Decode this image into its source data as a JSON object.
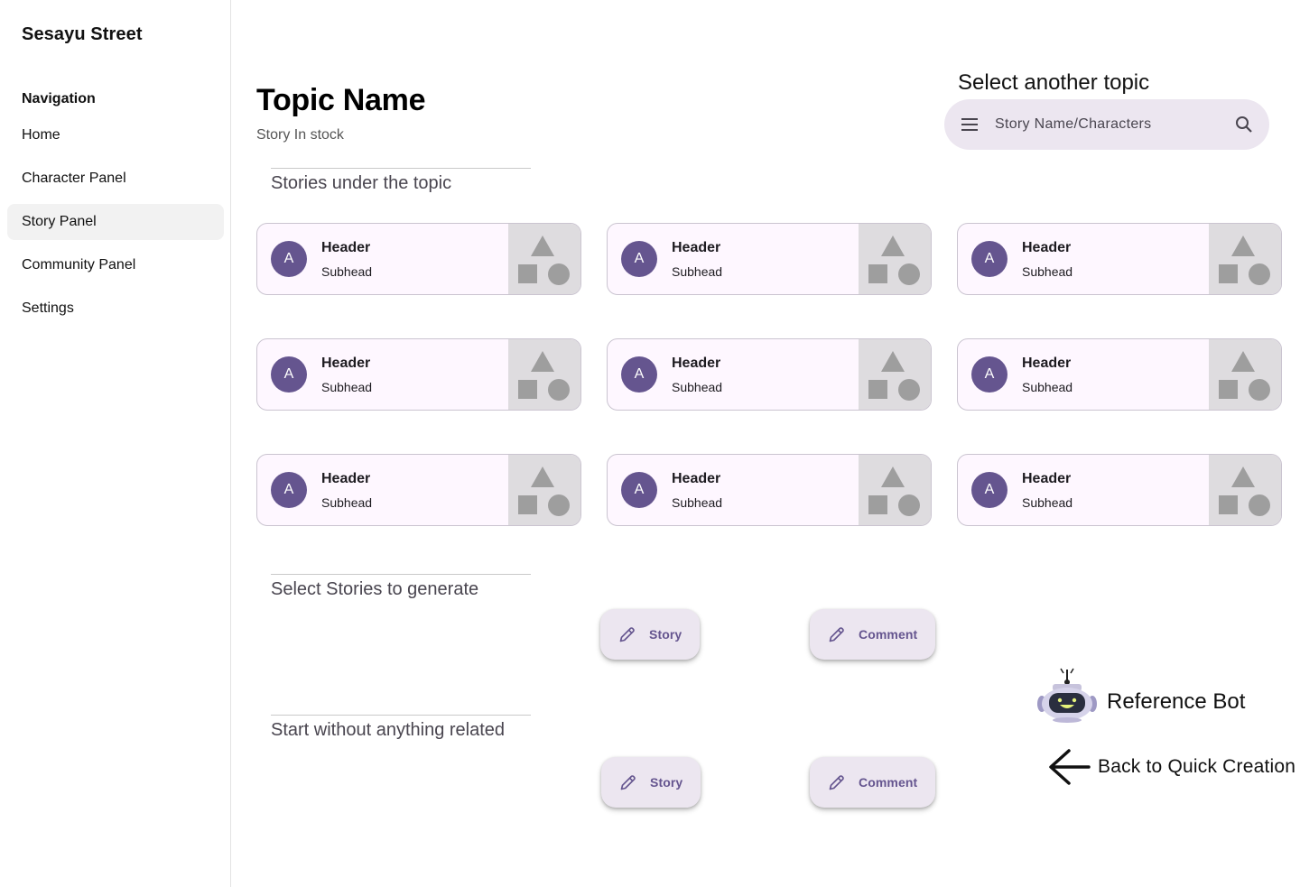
{
  "app": {
    "brand": "Sesayu Street"
  },
  "sidebar": {
    "heading": "Navigation",
    "items": [
      {
        "label": "Home",
        "active": false
      },
      {
        "label": "Character Panel",
        "active": false
      },
      {
        "label": "Story Panel",
        "active": true
      },
      {
        "label": "Community Panel",
        "active": false
      },
      {
        "label": "Settings",
        "active": false
      }
    ]
  },
  "main": {
    "title": "Topic Name",
    "subtitle": "Story In stock",
    "topic_select": {
      "label": "Select another topic",
      "placeholder": "Story Name/Characters",
      "menu_icon": "menu-icon",
      "search_icon": "search-icon"
    },
    "sections": {
      "stories": "Stories under the topic",
      "select_generate": "Select Stories to generate",
      "start_blank": "Start without anything related"
    },
    "cards": [
      {
        "avatar": "A",
        "header": "Header",
        "subhead": "Subhead"
      },
      {
        "avatar": "A",
        "header": "Header",
        "subhead": "Subhead"
      },
      {
        "avatar": "A",
        "header": "Header",
        "subhead": "Subhead"
      },
      {
        "avatar": "A",
        "header": "Header",
        "subhead": "Subhead"
      },
      {
        "avatar": "A",
        "header": "Header",
        "subhead": "Subhead"
      },
      {
        "avatar": "A",
        "header": "Header",
        "subhead": "Subhead"
      },
      {
        "avatar": "A",
        "header": "Header",
        "subhead": "Subhead"
      },
      {
        "avatar": "A",
        "header": "Header",
        "subhead": "Subhead"
      },
      {
        "avatar": "A",
        "header": "Header",
        "subhead": "Subhead"
      }
    ],
    "generate_buttons": {
      "story": "Story",
      "comment": "Comment"
    },
    "blank_buttons": {
      "story": "Story",
      "comment": "Comment"
    },
    "bot": {
      "label": "Reference Bot",
      "icon": "robot-icon"
    },
    "back": {
      "label": "Back to Quick Creation",
      "icon": "arrow-left-icon"
    }
  },
  "colors": {
    "accent": "#65558f",
    "card_bg": "#fef7ff",
    "card_border": "#cac4d0",
    "surface_container": "#ece6f0",
    "media_placeholder": "#dedcdf"
  }
}
